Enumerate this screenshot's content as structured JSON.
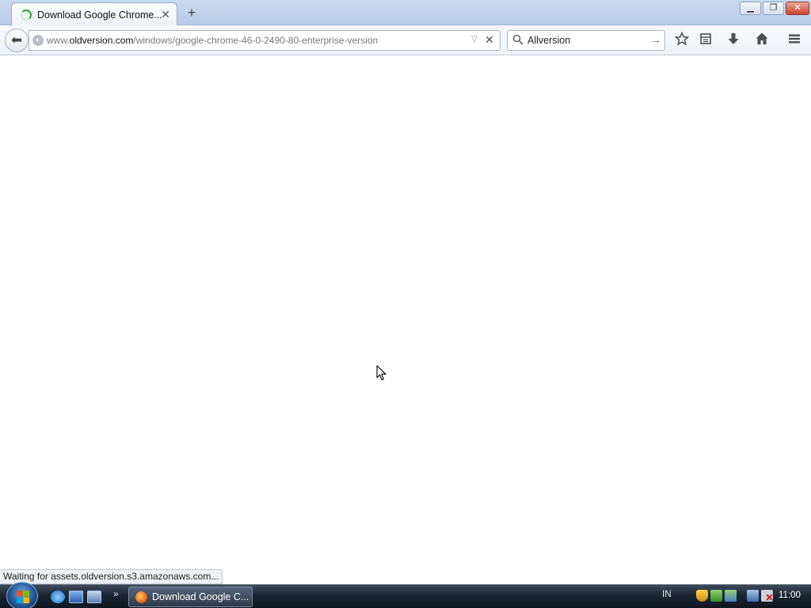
{
  "tab": {
    "title": "Download Google Chrome...",
    "close_glyph": "✕",
    "spinner_icon": "loading-spinner-icon"
  },
  "new_tab_glyph": "+",
  "window_controls": {
    "minimize": "▁",
    "maximize": "❐",
    "close": "✕"
  },
  "navbar": {
    "back_glyph": "⬅",
    "url_prefix": "www.",
    "url_domain": "oldversion.com",
    "url_path": "/windows/google-chrome-46-0-2490-80-enterprise-version",
    "dropdown_glyph": "▽",
    "stop_glyph": "✕",
    "search_value": "Allversion",
    "search_go_glyph": "→",
    "toolbar_icons": [
      "bookmark-star-icon",
      "reading-list-icon",
      "downloads-icon",
      "home-icon",
      "menu-icon"
    ]
  },
  "status": {
    "text": "Waiting for assets.oldversion.s3.amazonaws.com..."
  },
  "taskbar": {
    "overflow_glyph": "»",
    "task_title": "Download Google C...",
    "language": "IN",
    "clock": "11:00"
  },
  "colors": {
    "accent": "#29a329",
    "titlebar": "#c9d9ee",
    "taskbar": "#1b2634"
  }
}
